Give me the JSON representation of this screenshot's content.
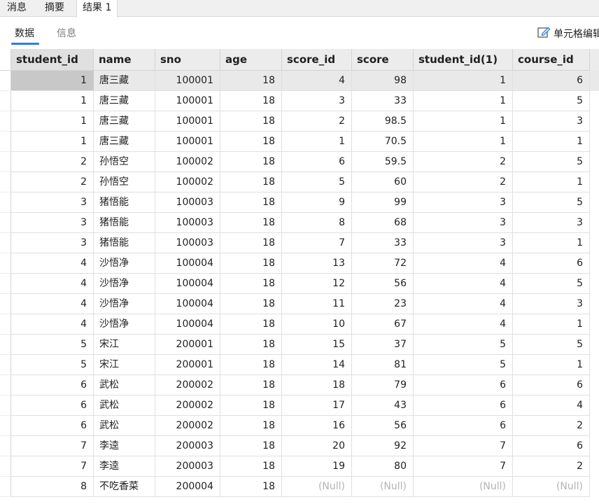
{
  "top_tabs": [
    {
      "label": "消息"
    },
    {
      "label": "摘要"
    },
    {
      "label": "结果 1"
    }
  ],
  "sub_tabs": [
    {
      "label": "数据"
    },
    {
      "label": "信息"
    }
  ],
  "cell_edit_label": "单元格编辑",
  "columns": [
    "student_id",
    "name",
    "sno",
    "age",
    "score_id",
    "score",
    "student_id(1)",
    "course_id"
  ],
  "rows": [
    [
      "1",
      "唐三藏",
      "100001",
      "18",
      "4",
      "98",
      "1",
      "6"
    ],
    [
      "1",
      "唐三藏",
      "100001",
      "18",
      "3",
      "33",
      "1",
      "5"
    ],
    [
      "1",
      "唐三藏",
      "100001",
      "18",
      "2",
      "98.5",
      "1",
      "3"
    ],
    [
      "1",
      "唐三藏",
      "100001",
      "18",
      "1",
      "70.5",
      "1",
      "1"
    ],
    [
      "2",
      "孙悟空",
      "100002",
      "18",
      "6",
      "59.5",
      "2",
      "5"
    ],
    [
      "2",
      "孙悟空",
      "100002",
      "18",
      "5",
      "60",
      "2",
      "1"
    ],
    [
      "3",
      "猪悟能",
      "100003",
      "18",
      "9",
      "99",
      "3",
      "5"
    ],
    [
      "3",
      "猪悟能",
      "100003",
      "18",
      "8",
      "68",
      "3",
      "3"
    ],
    [
      "3",
      "猪悟能",
      "100003",
      "18",
      "7",
      "33",
      "3",
      "1"
    ],
    [
      "4",
      "沙悟净",
      "100004",
      "18",
      "13",
      "72",
      "4",
      "6"
    ],
    [
      "4",
      "沙悟净",
      "100004",
      "18",
      "12",
      "56",
      "4",
      "5"
    ],
    [
      "4",
      "沙悟净",
      "100004",
      "18",
      "11",
      "23",
      "4",
      "3"
    ],
    [
      "4",
      "沙悟净",
      "100004",
      "18",
      "10",
      "67",
      "4",
      "1"
    ],
    [
      "5",
      "宋江",
      "200001",
      "18",
      "15",
      "37",
      "5",
      "5"
    ],
    [
      "5",
      "宋江",
      "200001",
      "18",
      "14",
      "81",
      "5",
      "1"
    ],
    [
      "6",
      "武松",
      "200002",
      "18",
      "18",
      "79",
      "6",
      "6"
    ],
    [
      "6",
      "武松",
      "200002",
      "18",
      "17",
      "43",
      "6",
      "4"
    ],
    [
      "6",
      "武松",
      "200002",
      "18",
      "16",
      "56",
      "6",
      "2"
    ],
    [
      "7",
      "李逵",
      "200003",
      "18",
      "20",
      "92",
      "7",
      "6"
    ],
    [
      "7",
      "李逵",
      "200003",
      "18",
      "19",
      "80",
      "7",
      "2"
    ],
    [
      "8",
      "不吃香菜",
      "200004",
      "18",
      "(Null)",
      "(Null)",
      "(Null)",
      "(Null)"
    ]
  ],
  "null_text": "(Null)",
  "selected_row": 0,
  "colors": {
    "accent": "#2a7de1",
    "header_bg": "#ececec",
    "selected_row_bg": "#e9e9e9",
    "selected_cell_bg": "#c8c8c8",
    "null_text": "#b4b4b4"
  },
  "icons": {
    "cell_edit": "pencil-edit-icon"
  }
}
